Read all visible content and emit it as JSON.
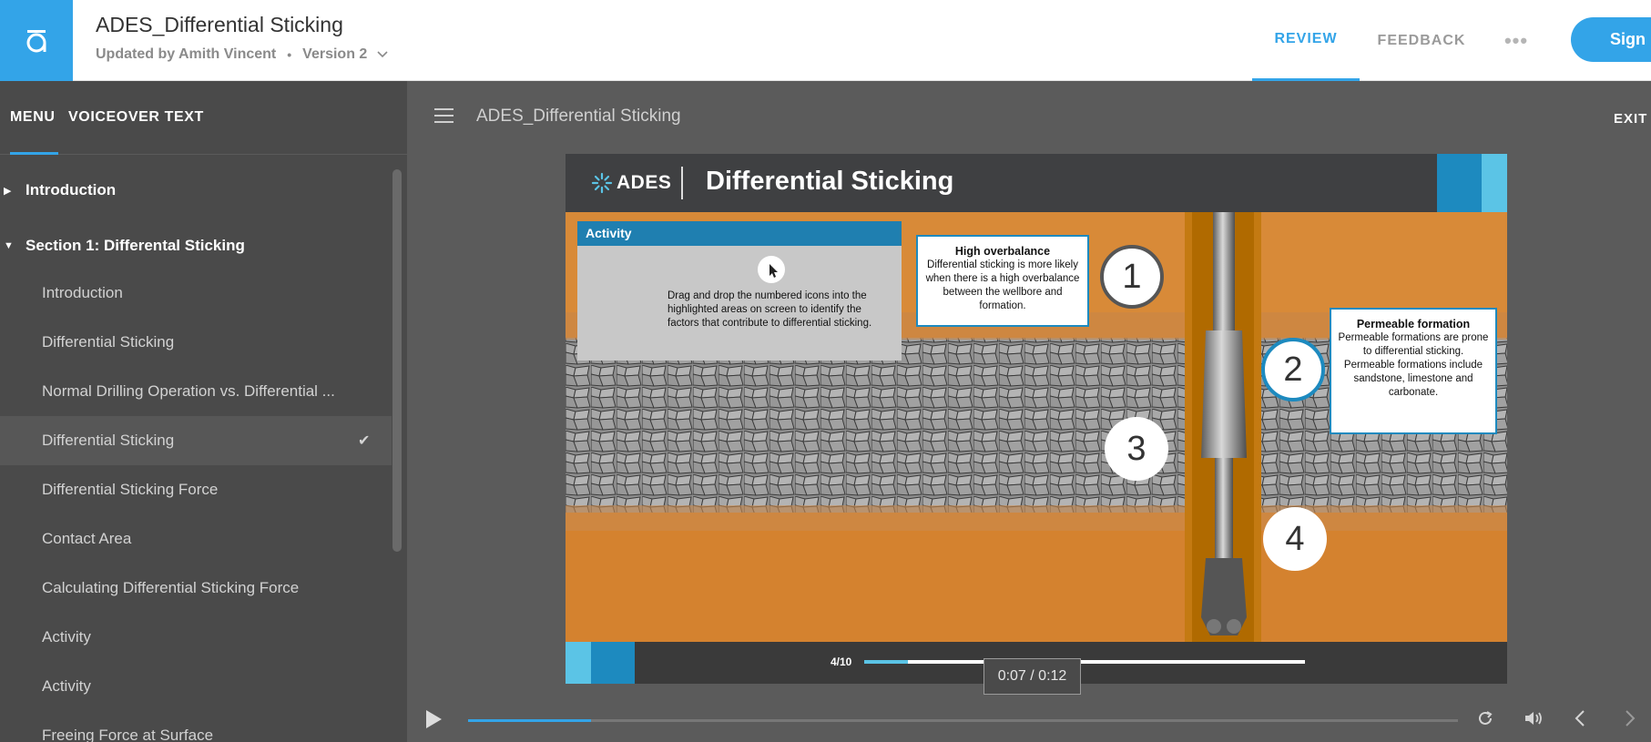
{
  "header": {
    "project_title": "ADES_Differential Sticking",
    "updated_by": "Updated by Amith Vincent",
    "bullet": "•",
    "version": "Version 2",
    "nav_review": "REVIEW",
    "nav_feedback": "FEEDBACK",
    "nav_more": "•••",
    "sign_in": "Sign In"
  },
  "sidebar": {
    "tab_menu": "MENU",
    "tab_voiceover": "VOICEOVER TEXT",
    "section_intro": "Introduction",
    "section_1": "Section 1: Differental Sticking",
    "items": [
      {
        "label": "Introduction"
      },
      {
        "label": "Differential Sticking"
      },
      {
        "label": "Normal Drilling Operation vs. Differential ..."
      },
      {
        "label": "Differential Sticking",
        "active": true
      },
      {
        "label": "Differential Sticking Force"
      },
      {
        "label": "Contact Area"
      },
      {
        "label": "Calculating Differential Sticking Force"
      },
      {
        "label": "Activity"
      },
      {
        "label": "Activity"
      },
      {
        "label": "Freeing Force at Surface"
      }
    ]
  },
  "main": {
    "breadcrumb": "ADES_Differential Sticking",
    "exit": "EXIT"
  },
  "slide": {
    "brand": "ADES",
    "title": "Differential Sticking",
    "activity_title": "Activity",
    "activity_text": "Drag and drop the numbered icons into the highlighted areas on screen to identify the factors that contribute to differential sticking.",
    "high_overbalance_title": "High overbalance",
    "high_overbalance_text": "Differential sticking is more likely when there is a high overbalance between the wellbore and formation.",
    "permeable_title": "Permeable formation",
    "permeable_text": "Permeable formations are  prone to differential sticking. Permeable formations include sandstone, limestone and carbonate.",
    "numbers": [
      "1",
      "2",
      "3",
      "4"
    ],
    "counter": "4/10",
    "slide_progress": 0.1,
    "time_tooltip": "0:07 / 0:12"
  },
  "player": {
    "progress": 0.124
  },
  "colors": {
    "brand_blue": "#33a4e8",
    "accent_dark": "#1d8abf",
    "accent_light": "#5bc4e6",
    "rock_orange": "#d9863c"
  }
}
